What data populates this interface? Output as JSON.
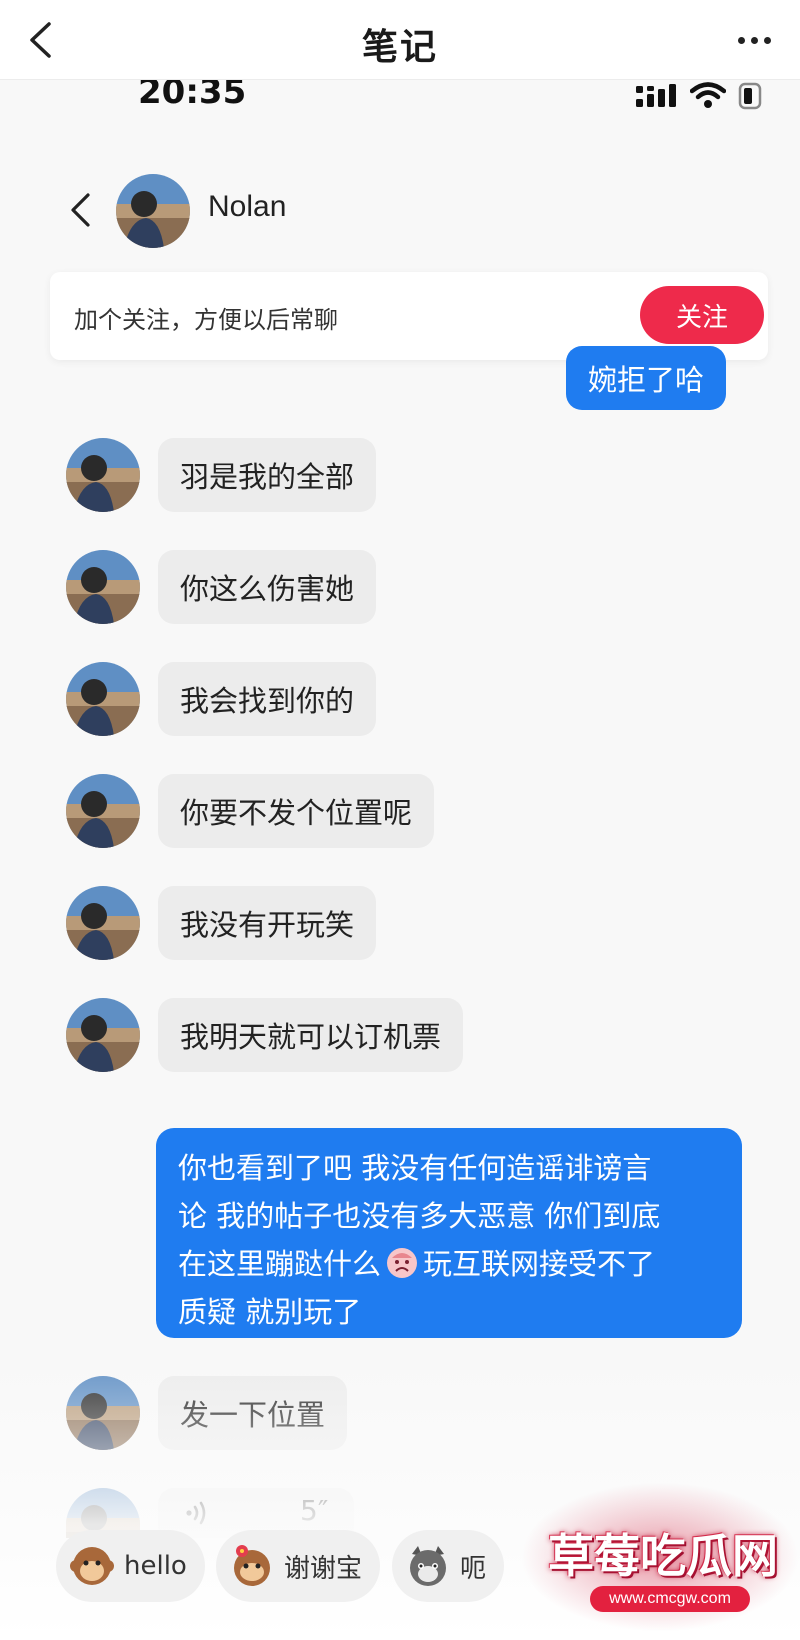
{
  "app_header": {
    "title": "笔记"
  },
  "status_bar": {
    "time": "20:35"
  },
  "chat": {
    "contact_name": "Nolan",
    "follow_prompt": "加个关注，方便以后常聊",
    "follow_button": "关注"
  },
  "messages": [
    {
      "side": "out",
      "text": "婉拒了哈"
    },
    {
      "side": "in",
      "text": "羽是我的全部"
    },
    {
      "side": "in",
      "text": "你这么伤害她"
    },
    {
      "side": "in",
      "text": "我会找到你的"
    },
    {
      "side": "in",
      "text": "你要不发个位置呢"
    },
    {
      "side": "in",
      "text": "我没有开玩笑"
    },
    {
      "side": "in",
      "text": "我明天就可以订机票"
    },
    {
      "side": "out",
      "line1": "你也看到了吧 我没有任何造谣诽谤言",
      "line2": "论 我的帖子也没有多大恶意 你们到底",
      "line3a": "在这里蹦跶什么",
      "line3b": "玩互联网接受不了",
      "line4": "质疑 就别玩了"
    },
    {
      "side": "in",
      "text": "发一下位置"
    },
    {
      "side": "in",
      "type": "voice",
      "duration": "5″"
    }
  ],
  "quick_replies": [
    {
      "label": "hello",
      "icon": "monkey-emoji-icon"
    },
    {
      "label": "谢谢宝",
      "icon": "monkey-flower-emoji-icon"
    },
    {
      "label": "呃",
      "icon": "cat-emoji-icon"
    }
  ],
  "watermark": {
    "text": "草莓吃瓜网",
    "url": "www.cmcgw.com"
  },
  "colors": {
    "accent_blue": "#1f7cf0",
    "follow_red": "#ee2a4b",
    "bubble_gray": "#ececec"
  }
}
